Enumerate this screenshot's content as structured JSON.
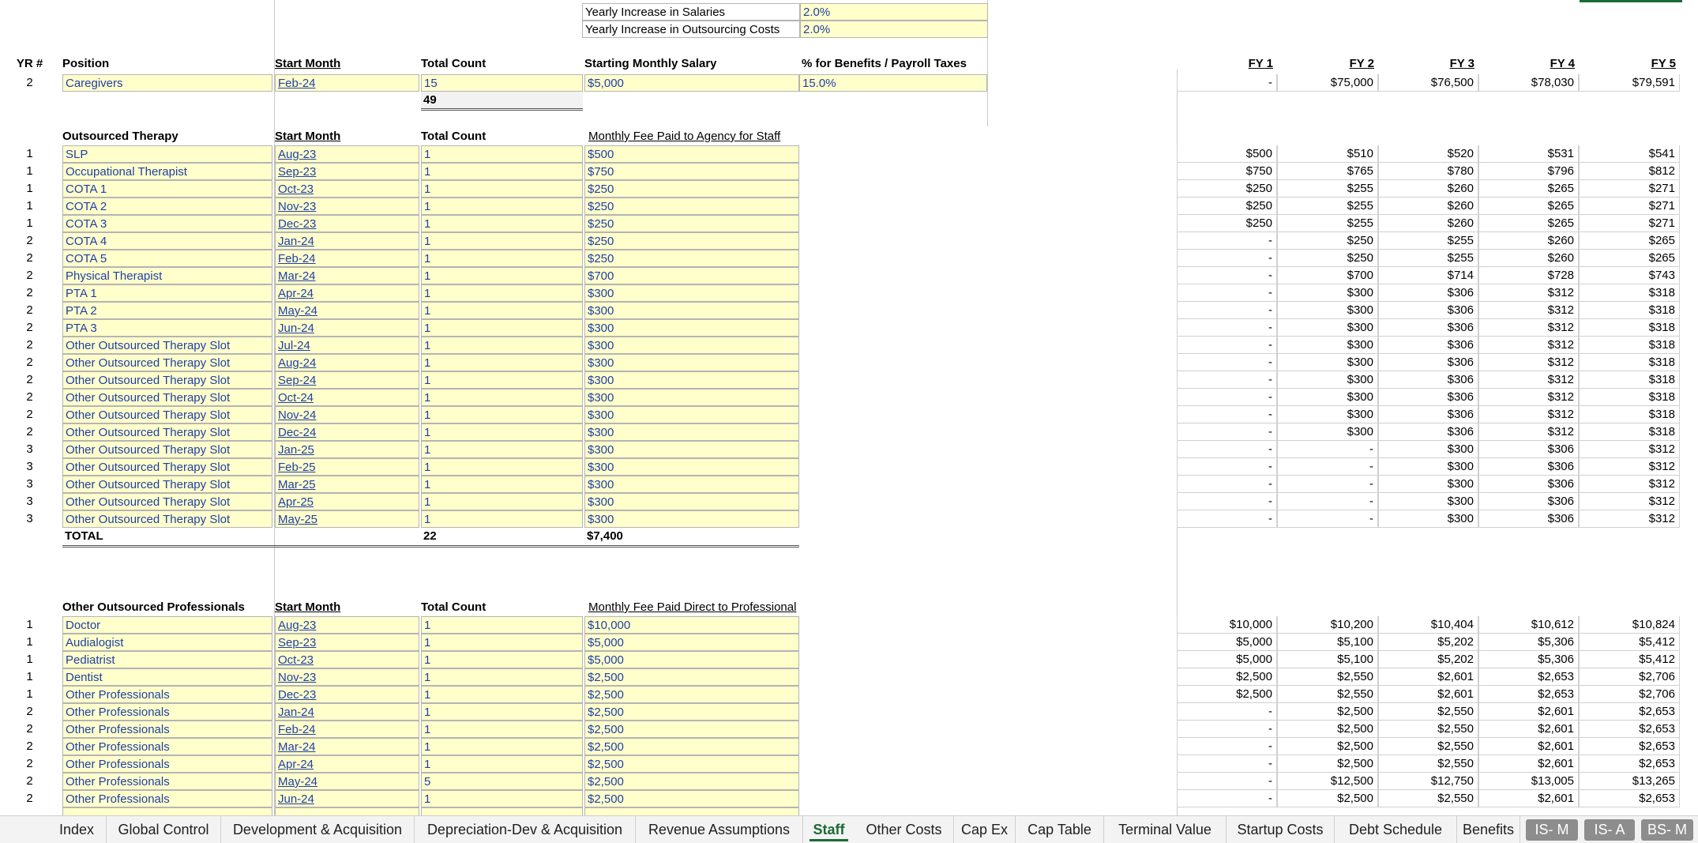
{
  "assumptions": [
    {
      "label": "Yearly Increase in Salaries",
      "value": "2.0%"
    },
    {
      "label": "Yearly Increase in Outsourcing Costs",
      "value": "2.0%"
    }
  ],
  "fy_headers": [
    "FY 1",
    "FY 2",
    "FY 3",
    "FY 4",
    "FY 5"
  ],
  "salaried": {
    "headers": {
      "yr": "YR #",
      "position": "Position",
      "start": "Start Month",
      "count": "Total Count",
      "salary": "Starting Monthly Salary",
      "benefits": "% for Benefits / Payroll Taxes"
    },
    "rows": [
      {
        "yr": "2",
        "position": "Caregivers",
        "start": "Feb-24",
        "count": "15",
        "salary": "$5,000",
        "benefits": "15.0%",
        "fy": [
          "-",
          "$75,000",
          "$76,500",
          "$78,030",
          "$79,591"
        ]
      }
    ],
    "total_count": "49"
  },
  "therapy": {
    "headers": {
      "section": "Outsourced Therapy",
      "start": "Start Month",
      "count": "Total Count",
      "fee": "Monthly Fee Paid to Agency for Staff"
    },
    "rows": [
      {
        "yr": "1",
        "position": "SLP",
        "start": "Aug-23",
        "count": "1",
        "fee": "$500",
        "fy": [
          "$500",
          "$510",
          "$520",
          "$531",
          "$541"
        ]
      },
      {
        "yr": "1",
        "position": "Occupational Therapist",
        "start": "Sep-23",
        "count": "1",
        "fee": "$750",
        "fy": [
          "$750",
          "$765",
          "$780",
          "$796",
          "$812"
        ]
      },
      {
        "yr": "1",
        "position": "COTA 1",
        "start": "Oct-23",
        "count": "1",
        "fee": "$250",
        "fy": [
          "$250",
          "$255",
          "$260",
          "$265",
          "$271"
        ]
      },
      {
        "yr": "1",
        "position": "COTA 2",
        "start": "Nov-23",
        "count": "1",
        "fee": "$250",
        "fy": [
          "$250",
          "$255",
          "$260",
          "$265",
          "$271"
        ]
      },
      {
        "yr": "1",
        "position": "COTA 3",
        "start": "Dec-23",
        "count": "1",
        "fee": "$250",
        "fy": [
          "$250",
          "$255",
          "$260",
          "$265",
          "$271"
        ]
      },
      {
        "yr": "2",
        "position": "COTA 4",
        "start": "Jan-24",
        "count": "1",
        "fee": "$250",
        "fy": [
          "-",
          "$250",
          "$255",
          "$260",
          "$265"
        ]
      },
      {
        "yr": "2",
        "position": "COTA 5",
        "start": "Feb-24",
        "count": "1",
        "fee": "$250",
        "fy": [
          "-",
          "$250",
          "$255",
          "$260",
          "$265"
        ]
      },
      {
        "yr": "2",
        "position": "Physical Therapist",
        "start": "Mar-24",
        "count": "1",
        "fee": "$700",
        "fy": [
          "-",
          "$700",
          "$714",
          "$728",
          "$743"
        ]
      },
      {
        "yr": "2",
        "position": "PTA 1",
        "start": "Apr-24",
        "count": "1",
        "fee": "$300",
        "fy": [
          "-",
          "$300",
          "$306",
          "$312",
          "$318"
        ]
      },
      {
        "yr": "2",
        "position": "PTA 2",
        "start": "May-24",
        "count": "1",
        "fee": "$300",
        "fy": [
          "-",
          "$300",
          "$306",
          "$312",
          "$318"
        ]
      },
      {
        "yr": "2",
        "position": "PTA 3",
        "start": "Jun-24",
        "count": "1",
        "fee": "$300",
        "fy": [
          "-",
          "$300",
          "$306",
          "$312",
          "$318"
        ]
      },
      {
        "yr": "2",
        "position": "Other Outsourced Therapy Slot",
        "start": "Jul-24",
        "count": "1",
        "fee": "$300",
        "fy": [
          "-",
          "$300",
          "$306",
          "$312",
          "$318"
        ]
      },
      {
        "yr": "2",
        "position": "Other Outsourced Therapy Slot",
        "start": "Aug-24",
        "count": "1",
        "fee": "$300",
        "fy": [
          "-",
          "$300",
          "$306",
          "$312",
          "$318"
        ]
      },
      {
        "yr": "2",
        "position": "Other Outsourced Therapy Slot",
        "start": "Sep-24",
        "count": "1",
        "fee": "$300",
        "fy": [
          "-",
          "$300",
          "$306",
          "$312",
          "$318"
        ]
      },
      {
        "yr": "2",
        "position": "Other Outsourced Therapy Slot",
        "start": "Oct-24",
        "count": "1",
        "fee": "$300",
        "fy": [
          "-",
          "$300",
          "$306",
          "$312",
          "$318"
        ]
      },
      {
        "yr": "2",
        "position": "Other Outsourced Therapy Slot",
        "start": "Nov-24",
        "count": "1",
        "fee": "$300",
        "fy": [
          "-",
          "$300",
          "$306",
          "$312",
          "$318"
        ]
      },
      {
        "yr": "2",
        "position": "Other Outsourced Therapy Slot",
        "start": "Dec-24",
        "count": "1",
        "fee": "$300",
        "fy": [
          "-",
          "$300",
          "$306",
          "$312",
          "$318"
        ]
      },
      {
        "yr": "3",
        "position": "Other Outsourced Therapy Slot",
        "start": "Jan-25",
        "count": "1",
        "fee": "$300",
        "fy": [
          "-",
          "-",
          "$300",
          "$306",
          "$312"
        ]
      },
      {
        "yr": "3",
        "position": "Other Outsourced Therapy Slot",
        "start": "Feb-25",
        "count": "1",
        "fee": "$300",
        "fy": [
          "-",
          "-",
          "$300",
          "$306",
          "$312"
        ]
      },
      {
        "yr": "3",
        "position": "Other Outsourced Therapy Slot",
        "start": "Mar-25",
        "count": "1",
        "fee": "$300",
        "fy": [
          "-",
          "-",
          "$300",
          "$306",
          "$312"
        ]
      },
      {
        "yr": "3",
        "position": "Other Outsourced Therapy Slot",
        "start": "Apr-25",
        "count": "1",
        "fee": "$300",
        "fy": [
          "-",
          "-",
          "$300",
          "$306",
          "$312"
        ]
      },
      {
        "yr": "3",
        "position": "Other Outsourced Therapy Slot",
        "start": "May-25",
        "count": "1",
        "fee": "$300",
        "fy": [
          "-",
          "-",
          "$300",
          "$306",
          "$312"
        ]
      }
    ],
    "total": {
      "label": "TOTAL",
      "count": "22",
      "fee": "$7,400"
    }
  },
  "professionals": {
    "headers": {
      "section": "Other Outsourced Professionals",
      "start": "Start Month",
      "count": "Total Count",
      "fee": "Monthly Fee Paid Direct to Professional"
    },
    "rows": [
      {
        "yr": "1",
        "position": "Doctor",
        "start": "Aug-23",
        "count": "1",
        "fee": "$10,000",
        "fy": [
          "$10,000",
          "$10,200",
          "$10,404",
          "$10,612",
          "$10,824"
        ]
      },
      {
        "yr": "1",
        "position": "Audialogist",
        "start": "Sep-23",
        "count": "1",
        "fee": "$5,000",
        "fy": [
          "$5,000",
          "$5,100",
          "$5,202",
          "$5,306",
          "$5,412"
        ]
      },
      {
        "yr": "1",
        "position": "Pediatrist",
        "start": "Oct-23",
        "count": "1",
        "fee": "$5,000",
        "fy": [
          "$5,000",
          "$5,100",
          "$5,202",
          "$5,306",
          "$5,412"
        ]
      },
      {
        "yr": "1",
        "position": "Dentist",
        "start": "Nov-23",
        "count": "1",
        "fee": "$2,500",
        "fy": [
          "$2,500",
          "$2,550",
          "$2,601",
          "$2,653",
          "$2,706"
        ]
      },
      {
        "yr": "1",
        "position": "Other Professionals",
        "start": "Dec-23",
        "count": "1",
        "fee": "$2,500",
        "fy": [
          "$2,500",
          "$2,550",
          "$2,601",
          "$2,653",
          "$2,706"
        ]
      },
      {
        "yr": "2",
        "position": "Other Professionals",
        "start": "Jan-24",
        "count": "1",
        "fee": "$2,500",
        "fy": [
          "-",
          "$2,500",
          "$2,550",
          "$2,601",
          "$2,653"
        ]
      },
      {
        "yr": "2",
        "position": "Other Professionals",
        "start": "Feb-24",
        "count": "1",
        "fee": "$2,500",
        "fy": [
          "-",
          "$2,500",
          "$2,550",
          "$2,601",
          "$2,653"
        ]
      },
      {
        "yr": "2",
        "position": "Other Professionals",
        "start": "Mar-24",
        "count": "1",
        "fee": "$2,500",
        "fy": [
          "-",
          "$2,500",
          "$2,550",
          "$2,601",
          "$2,653"
        ]
      },
      {
        "yr": "2",
        "position": "Other Professionals",
        "start": "Apr-24",
        "count": "1",
        "fee": "$2,500",
        "fy": [
          "-",
          "$2,500",
          "$2,550",
          "$2,601",
          "$2,653"
        ]
      },
      {
        "yr": "2",
        "position": "Other Professionals",
        "start": "May-24",
        "count": "5",
        "fee": "$2,500",
        "fy": [
          "-",
          "$12,500",
          "$12,750",
          "$13,005",
          "$13,265"
        ]
      },
      {
        "yr": "2",
        "position": "Other Professionals",
        "start": "Jun-24",
        "count": "1",
        "fee": "$2,500",
        "fy": [
          "-",
          "$2,500",
          "$2,550",
          "$2,601",
          "$2,653"
        ]
      }
    ]
  },
  "tabs": [
    {
      "label": "Index",
      "state": "normal"
    },
    {
      "label": "Global Control",
      "state": "normal"
    },
    {
      "label": "Development & Acquisition",
      "state": "normal"
    },
    {
      "label": "Depreciation-Dev & Acquisition",
      "state": "normal"
    },
    {
      "label": "Revenue Assumptions",
      "state": "normal"
    },
    {
      "label": "Staff",
      "state": "active"
    },
    {
      "label": "Other Costs",
      "state": "normal"
    },
    {
      "label": "Cap Ex",
      "state": "normal"
    },
    {
      "label": "Cap Table",
      "state": "normal"
    },
    {
      "label": "Terminal Value",
      "state": "normal"
    },
    {
      "label": "Startup Costs",
      "state": "normal"
    },
    {
      "label": "Debt Schedule",
      "state": "normal"
    },
    {
      "label": "Benefits",
      "state": "normal"
    },
    {
      "label": "IS- M",
      "state": "dark"
    },
    {
      "label": "IS- A",
      "state": "dark"
    },
    {
      "label": "BS- M",
      "state": "dark"
    }
  ]
}
